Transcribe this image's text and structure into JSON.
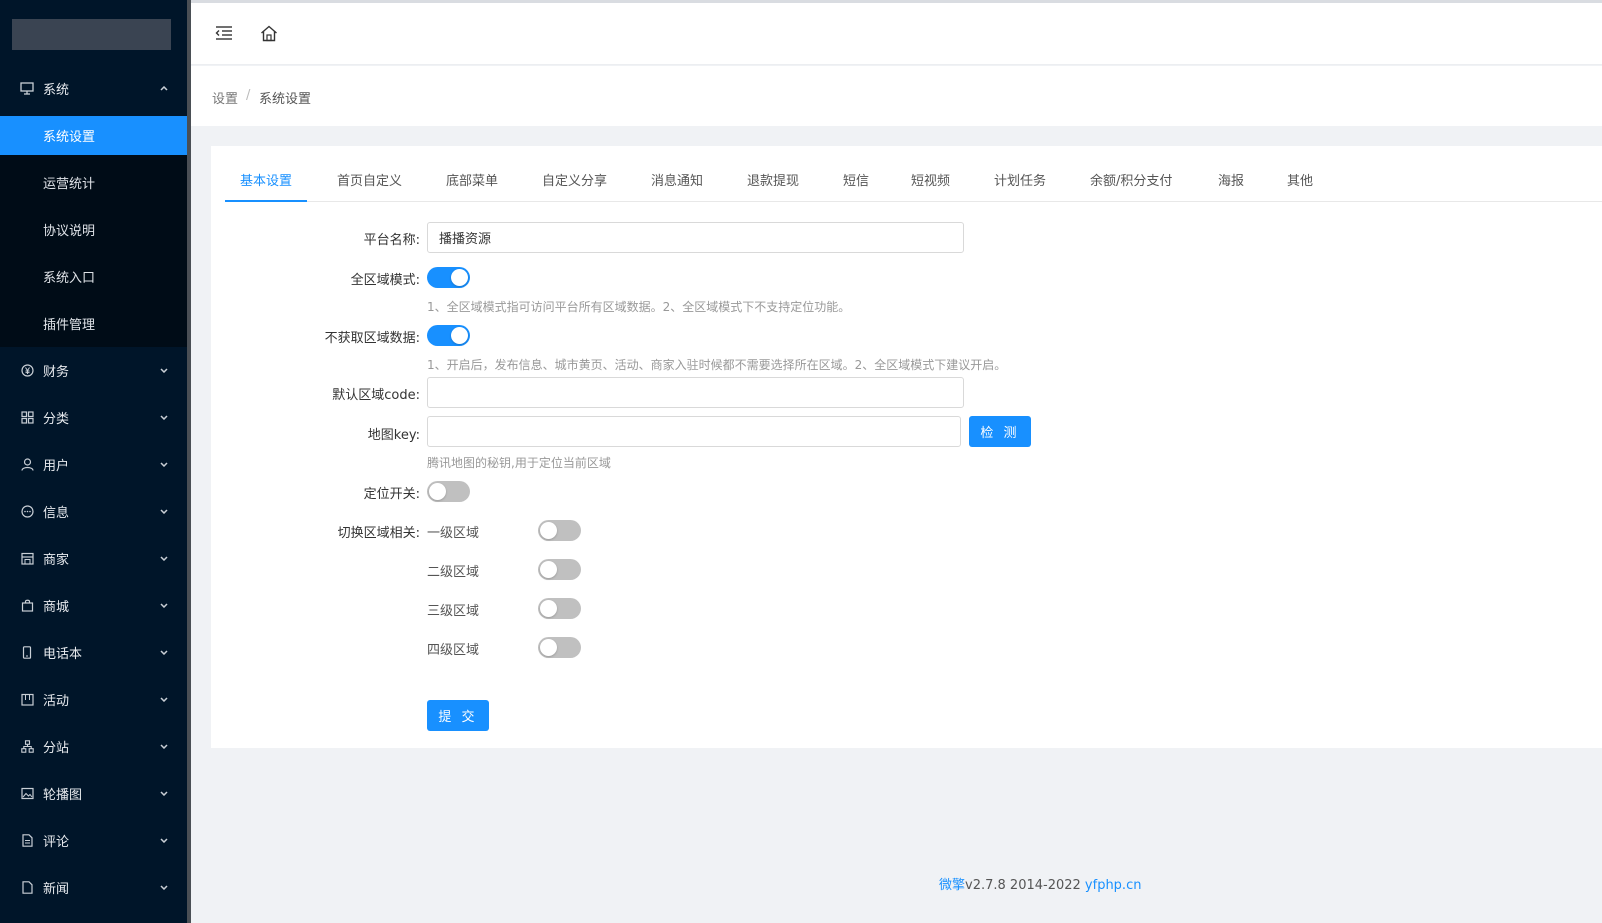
{
  "colors": {
    "sidebar_bg": "#001529",
    "accent": "#1890ff",
    "page_bg": "#f0f2f5"
  },
  "sidebar": {
    "group_open": {
      "label": "系统",
      "icon": "monitor-icon"
    },
    "sub_items": [
      {
        "label": "系统设置",
        "active": true
      },
      {
        "label": "运营统计"
      },
      {
        "label": "协议说明"
      },
      {
        "label": "系统入口"
      },
      {
        "label": "插件管理"
      }
    ],
    "items": [
      {
        "label": "财务",
        "icon": "yen-circle-icon"
      },
      {
        "label": "分类",
        "icon": "grid-icon"
      },
      {
        "label": "用户",
        "icon": "user-icon"
      },
      {
        "label": "信息",
        "icon": "message-icon"
      },
      {
        "label": "商家",
        "icon": "shop-icon"
      },
      {
        "label": "商城",
        "icon": "bag-icon"
      },
      {
        "label": "电话本",
        "icon": "phone-icon"
      },
      {
        "label": "活动",
        "icon": "calendar-icon"
      },
      {
        "label": "分站",
        "icon": "sitemap-icon"
      },
      {
        "label": "轮播图",
        "icon": "picture-icon"
      },
      {
        "label": "评论",
        "icon": "document-icon"
      },
      {
        "label": "新闻",
        "icon": "file-icon"
      }
    ]
  },
  "header": {
    "menu_toggle_icon": "menu-fold-icon",
    "home_icon": "home-icon"
  },
  "breadcrumb": {
    "parent": "设置",
    "separator": "/",
    "current": "系统设置"
  },
  "tabs": [
    "基本设置",
    "首页自定义",
    "底部菜单",
    "自定义分享",
    "消息通知",
    "退款提现",
    "短信",
    "短视频",
    "计划任务",
    "余额/积分支付",
    "海报",
    "其他"
  ],
  "form": {
    "platform_name": {
      "label": "平台名称:",
      "value": "播播资源"
    },
    "all_region": {
      "label": "全区域模式:",
      "on": true,
      "hint": "1、全区域模式指可访问平台所有区域数据。2、全区域模式下不支持定位功能。"
    },
    "no_region": {
      "label": "不获取区域数据:",
      "on": true,
      "hint": "1、开启后，发布信息、城市黄页、活动、商家入驻时候都不需要选择所在区域。2、全区域模式下建议开启。"
    },
    "region_code": {
      "label": "默认区域code:",
      "value": ""
    },
    "map_key": {
      "label": "地图key:",
      "value": "",
      "button": "检 测",
      "hint": "腾讯地图的秘钥,用于定位当前区域"
    },
    "location_switch": {
      "label": "定位开关:",
      "on": false
    },
    "switch_region": {
      "label": "切换区域相关:",
      "levels": [
        {
          "label": "一级区域",
          "on": false
        },
        {
          "label": "二级区域",
          "on": false
        },
        {
          "label": "三级区域",
          "on": false
        },
        {
          "label": "四级区域",
          "on": false
        }
      ]
    },
    "submit": "提 交"
  },
  "footer": {
    "brand": "微擎",
    "version": "v2.7.8 2014-2022 ",
    "site": "yfphp.cn"
  }
}
